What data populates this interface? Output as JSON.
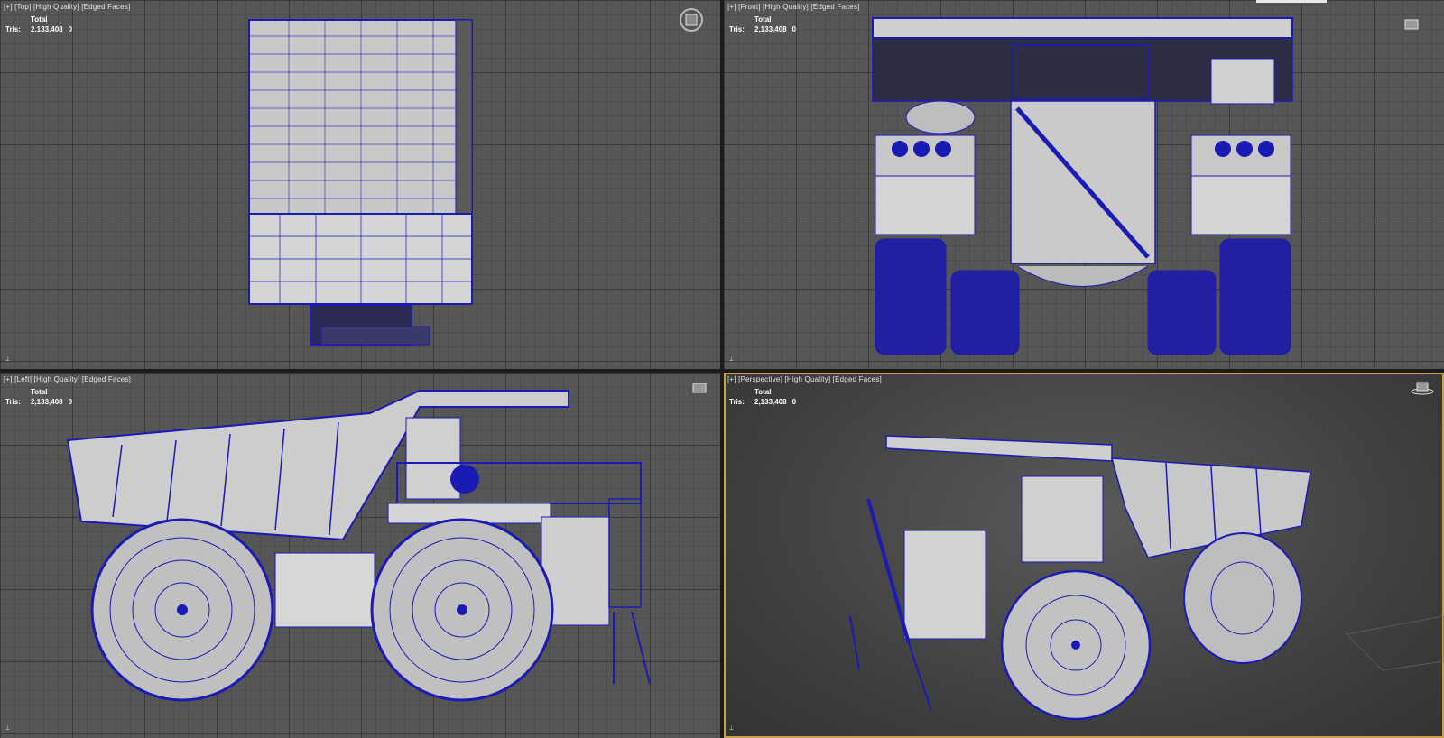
{
  "viewports": [
    {
      "id": "top",
      "label_plus": "[+]",
      "label_view": "[Top]",
      "label_shading": "[High Quality]",
      "label_edges": "[Edged Faces]"
    },
    {
      "id": "front",
      "label_plus": "[+]",
      "label_view": "[Front]",
      "label_shading": "[High Quality]",
      "label_edges": "[Edged Faces]"
    },
    {
      "id": "left",
      "label_plus": "[+]",
      "label_view": "[Left]",
      "label_shading": "[High Quality]",
      "label_edges": "[Edged Faces]"
    },
    {
      "id": "perspective",
      "label_plus": "[+]",
      "label_view": "[Perspective]",
      "label_shading": "[High Quality]",
      "label_edges": "[Edged Faces]"
    }
  ],
  "stats": {
    "total_label": "Total",
    "tris_label": "Tris:",
    "tris_total": "2,133,408",
    "tris_selected": "0"
  },
  "icons": {
    "viewcube_top": "viewcube-compass-icon",
    "viewcube_front": "viewcube-box-icon",
    "viewcube_left": "viewcube-box-icon",
    "viewcube_persp": "viewcube-box-icon",
    "axis": "world-axis-icon"
  },
  "colors": {
    "wire": "#1a1ab5",
    "mesh": "#cfcfcf",
    "active_border": "#c8a24a"
  }
}
